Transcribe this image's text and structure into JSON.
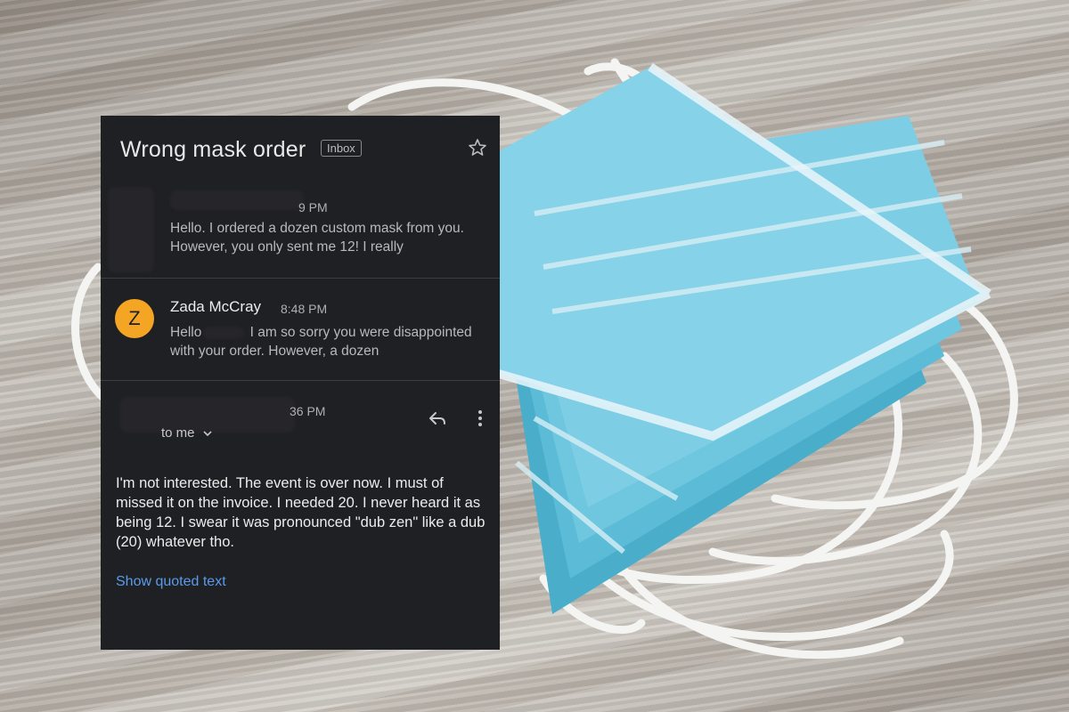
{
  "email": {
    "subject": "Wrong mask order",
    "label_badge": "Inbox",
    "messages": [
      {
        "sender": "",
        "time": "9 PM",
        "snippet": "Hello. I ordered a dozen custom mask from you. However, you only sent me 12! I really"
      },
      {
        "avatar_letter": "Z",
        "sender": "Zada McCray",
        "time": "8:48 PM",
        "snippet_prefix": "Hello",
        "snippet_rest": "I am so sorry you were disappointed with your order. However, a dozen"
      },
      {
        "sender": "",
        "time": "36 PM",
        "recipient": "to me",
        "body": "I'm not interested. The event is over now. I must of missed it on the invoice. I needed 20. I never heard it as being 12. I swear it was pronounced \"dub zen\" like a dub (20) whatever tho.",
        "show_quoted": "Show quoted text"
      }
    ]
  },
  "icons": {
    "star": "star-outline-icon",
    "reply": "reply-icon",
    "more": "more-vertical-icon",
    "expand": "chevron-down-icon"
  },
  "colors": {
    "panel_bg": "#1f2024",
    "avatar": "#f5a524",
    "link": "#5a9bea"
  }
}
